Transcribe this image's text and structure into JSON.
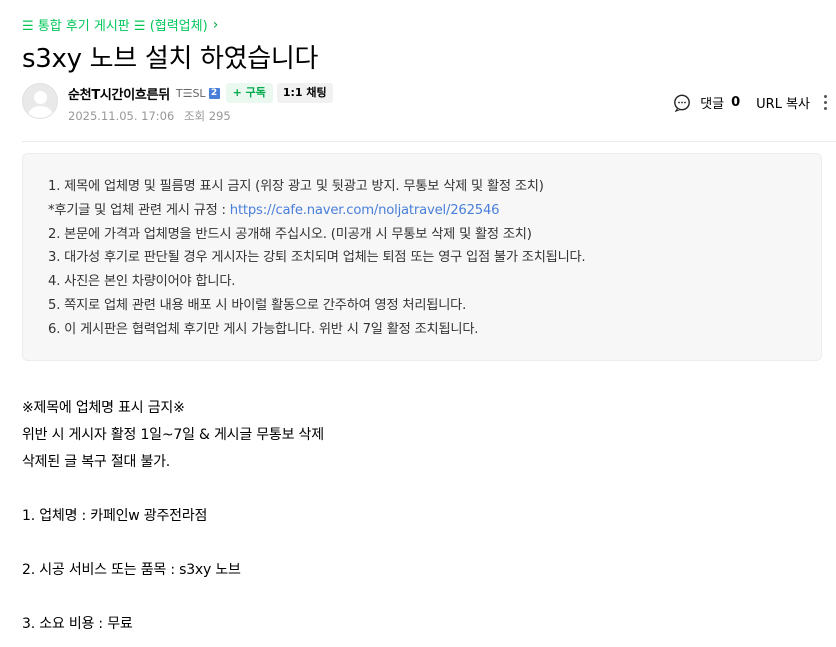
{
  "board": {
    "link_text": "☰ 통합 후기 게시판 ☰ (협력업체)",
    "chevron": "›"
  },
  "post": {
    "title": "s3xy 노브 설치 하였습니다"
  },
  "author": {
    "nickname": "순천T시간이흐른뒤",
    "level_text": "T☰SL",
    "level_badge": "2",
    "subscribe_label": "+ 구독",
    "chat_label": "1:1 채팅",
    "date": "2025.11.05. 17:06",
    "views": "조회 295"
  },
  "actions": {
    "comment_label": "댓글",
    "comment_count": "0",
    "url_copy_label": "URL 복사"
  },
  "notice": {
    "line1": "1. 제목에 업체명 및 필름명 표시 금지 (위장 광고 및 뒷광고 방지. 무통보 삭제 및 활정 조치)",
    "line2_prefix": "*후기글 및 업체 관련 게시 규정 : ",
    "line2_link": "https://cafe.naver.com/noljatravel/262546",
    "line3": "2. 본문에 가격과 업체명을 반드시 공개해 주십시오. (미공개 시 무통보 삭제 및 활정 조치)",
    "line4": "3. 대가성 후기로 판단될 경우 게시자는 강퇴 조치되며 업체는 퇴점 또는 영구 입점 불가 조치됩니다.",
    "line5": "4. 사진은 본인 차량이어야 합니다.",
    "line6": "5. 쪽지로 업체 관련 내용 배포 시 바이럴 활동으로 간주하여 영정 처리됩니다.",
    "line7": "6. 이 게시판은 협력업체 후기만 게시 가능합니다. 위반 시 7일 활정 조치됩니다."
  },
  "content": {
    "warn1": "※제목에 업체명 표시 금지※",
    "warn2": "위반 시 게시자 활정 1일~7일 & 게시글 무통보 삭제",
    "warn3": "삭제된 글 복구 절대 불가.",
    "item1": "1. 업체명 :  카페인w 광주전라점",
    "item2": "2. 시공 서비스 또는 품목 :  s3xy 노브",
    "item3": "3. 소요 비용 :  무료"
  },
  "colors": {
    "accent_green": "#03c75a",
    "link_blue": "#4a7fd9",
    "meta_gray": "#979797"
  }
}
